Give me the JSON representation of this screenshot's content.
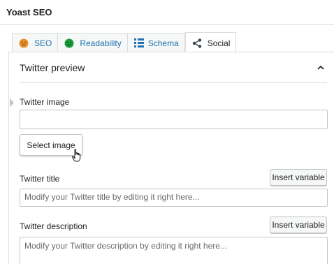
{
  "app": {
    "title": "Yoast SEO"
  },
  "tabs": [
    {
      "label": "SEO",
      "icon": "seo-smiley-orange-icon",
      "color": "#e58e2a"
    },
    {
      "label": "Readability",
      "icon": "readability-smiley-green-icon",
      "color": "#1a9b3c"
    },
    {
      "label": "Schema",
      "icon": "schema-grid-icon",
      "color": "#2271b1"
    },
    {
      "label": "Social",
      "icon": "share-icon",
      "active": true
    }
  ],
  "twitter_preview": {
    "heading": "Twitter preview",
    "image_label": "Twitter image",
    "image_value": "",
    "select_image_label": "Select image",
    "title_label": "Twitter title",
    "title_insert_variable": "Insert variable",
    "title_placeholder": "Modify your Twitter title by editing it right here...",
    "description_label": "Twitter description",
    "description_insert_variable": "Insert variable",
    "description_placeholder": "Modify your Twitter description by editing it right here..."
  },
  "colors": {
    "link": "#2271b1",
    "border": "#dcdcde"
  }
}
